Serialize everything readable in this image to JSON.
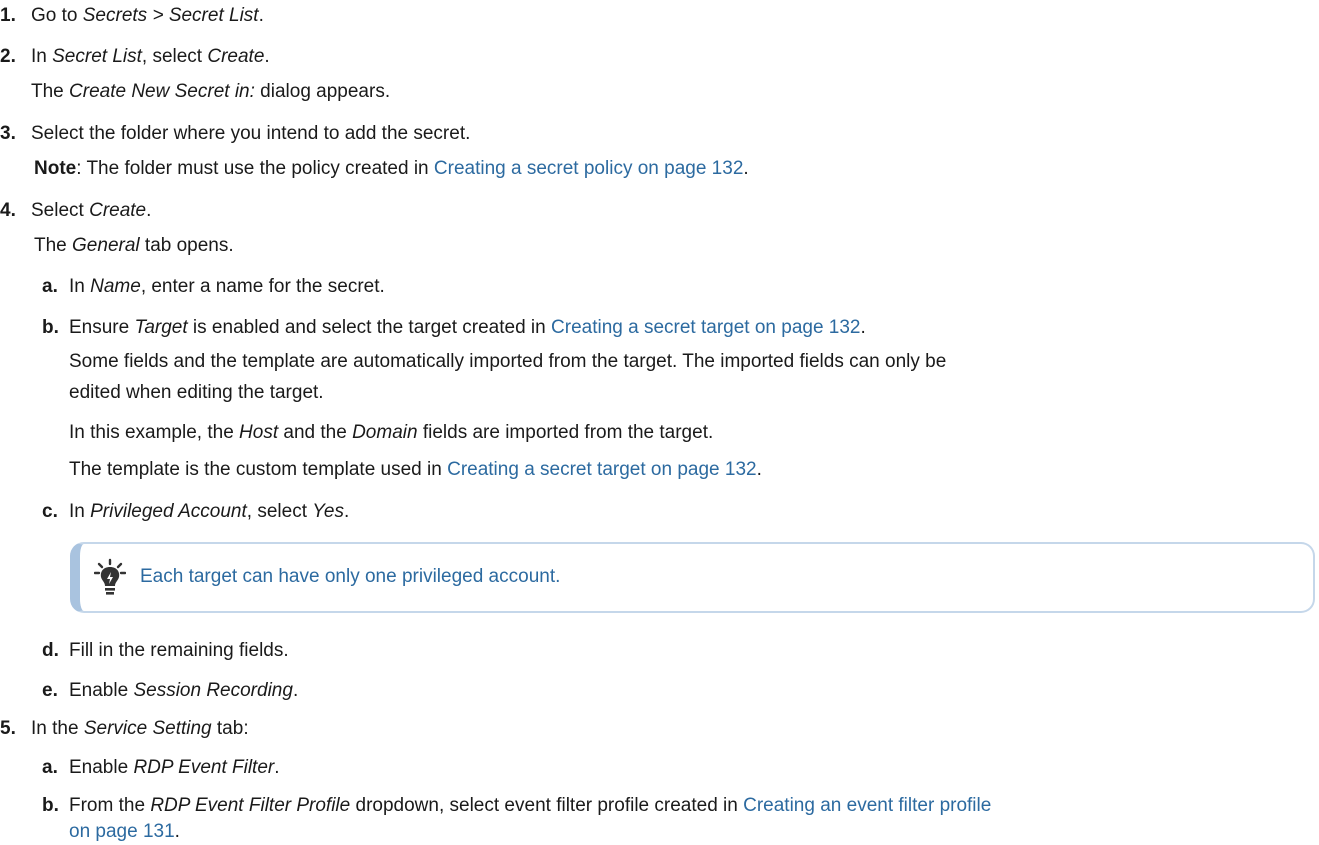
{
  "steps": [
    {
      "num": "1.",
      "pre": "Go to ",
      "em": "Secrets > Secret List",
      "post": "."
    },
    {
      "num": "2.",
      "pre": "In ",
      "em": "Secret List",
      "mid": ", select ",
      "em2": "Create",
      "post": ".",
      "sub_em": "Create New Secret in:",
      "sub_post": " dialog appears.",
      "sub_pre": "The "
    },
    {
      "num": "3.",
      "text": "Select the folder where you intend to add the secret.",
      "note_label": "Note",
      "note_text": ": The folder must use the policy created in ",
      "note_link": "Creating a secret policy on page 132",
      "note_post": "."
    },
    {
      "num": "4.",
      "pre": "Select ",
      "em": "Create",
      "post": ".",
      "sub_pre": "The ",
      "sub_em": "General",
      "sub_post": " tab opens."
    }
  ],
  "substeps4": [
    {
      "num": "a.",
      "pre": "In ",
      "em": "Name",
      "post": ", enter a name for the secret."
    },
    {
      "num": "b.",
      "pre": "Ensure ",
      "em": "Target",
      "mid": " is enabled and select the target created in ",
      "link": "Creating a secret target on page 132",
      "post": ".",
      "line2": " Some fields and the template are automatically imported from the target. The imported fields can only be",
      "line3": "edited when editing the target.",
      "line4_pre": "In this example, the ",
      "line4_em1": "Host",
      "line4_mid": " and the ",
      "line4_em2": "Domain",
      "line4_post": " fields are imported from the target.",
      "line5_pre": "The template is the custom template used in ",
      "line5_link": "Creating a secret target on page 132",
      "line5_post": "."
    },
    {
      "num": "c.",
      "pre": "In ",
      "em": "Privileged Account",
      "mid": ", select ",
      "em2": "Yes",
      "post": "."
    },
    {
      "num": "d.",
      "text": "Fill in the remaining fields."
    },
    {
      "num": "e.",
      "pre": "Enable ",
      "em": "Session Recording",
      "post": "."
    }
  ],
  "tip": {
    "text": "Each target can have only one privileged account.",
    "icon": "lightbulb-icon"
  },
  "step5": {
    "num": "5.",
    "pre": "In the ",
    "em": "Service Setting",
    "post": " tab:"
  },
  "substeps5": [
    {
      "num": "a.",
      "pre": "Enable ",
      "em": "RDP Event Filter",
      "post": "."
    },
    {
      "num": "b.",
      "pre": "From the ",
      "em": "RDP Event Filter Profile",
      "mid": " dropdown, select event filter profile created in ",
      "link": "Creating an event filter profile",
      "link2": "on page 131",
      "post": "."
    }
  ],
  "colors": {
    "text": "#1a1a1a",
    "link": "#2c6aa0",
    "tip_border": "#c5d7ea",
    "tip_accent": "#a9c3df"
  }
}
